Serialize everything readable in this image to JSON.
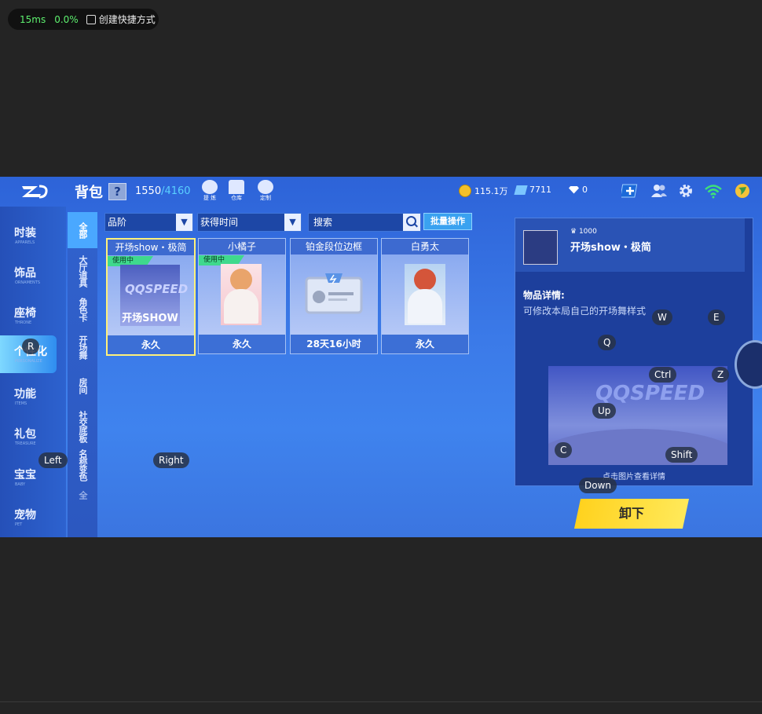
{
  "overlay": {
    "latency": "15ms",
    "loss": "0.0%",
    "shortcut_label": "创建快捷方式"
  },
  "topbar": {
    "title": "背包",
    "help": "?",
    "capacity_used": "1550",
    "capacity_total": "/4160",
    "icons": [
      {
        "name": "extract-icon",
        "label": "提 炼"
      },
      {
        "name": "warehouse-icon",
        "label": "仓库"
      },
      {
        "name": "custom-icon",
        "label": "定制"
      }
    ],
    "coins": "115.1万",
    "tickets": "7711",
    "diamonds": "0"
  },
  "sidebar": {
    "items": [
      {
        "cn": "时装",
        "en": "APPARELS"
      },
      {
        "cn": "饰品",
        "en": "ORNAMENTS"
      },
      {
        "cn": "座椅",
        "en": "THRONE"
      },
      {
        "cn": "个性化",
        "en": "PERSONALIZE"
      },
      {
        "cn": "功能",
        "en": "ITEMS"
      },
      {
        "cn": "礼包",
        "en": "TREASURE"
      },
      {
        "cn": "宝宝",
        "en": "BABY"
      },
      {
        "cn": "宠物",
        "en": "PET"
      }
    ]
  },
  "subtabs": [
    "全部",
    "大厅道具",
    "角色卡",
    "开场舞",
    "房间",
    "社交底板",
    "名称变色",
    "全"
  ],
  "filters": {
    "rank": "品阶",
    "time": "获得时间",
    "search_placeholder": "搜索",
    "batch": "批量操作"
  },
  "cards": [
    {
      "name": "开场show・极简",
      "footer": "永久",
      "inuse": "使用中",
      "art_text": "开场SHOW",
      "logo": "QQSPEED"
    },
    {
      "name": "小橘子",
      "footer": "永久",
      "inuse": "使用中"
    },
    {
      "name": "铂金段位边框",
      "footer": "28天16小时"
    },
    {
      "name": "白勇太",
      "footer": "永久"
    }
  ],
  "detail": {
    "price": "1000",
    "name": "开场show・极简",
    "label": "物品详情:",
    "desc": "可修改本局自己的开场舞样式",
    "preview_text": "QQSPEED",
    "caption": "点击图片查看详情"
  },
  "equip_button": "卸下",
  "keys": [
    "R",
    "W",
    "E",
    "Q",
    "Ctrl",
    "Z",
    "Up",
    "C",
    "Shift",
    "Down",
    "Left",
    "Right"
  ],
  "colors": {
    "accent_yellow": "#ffd21e",
    "inuse_green": "#3fd98d",
    "latency_green": "#5ef06f"
  }
}
